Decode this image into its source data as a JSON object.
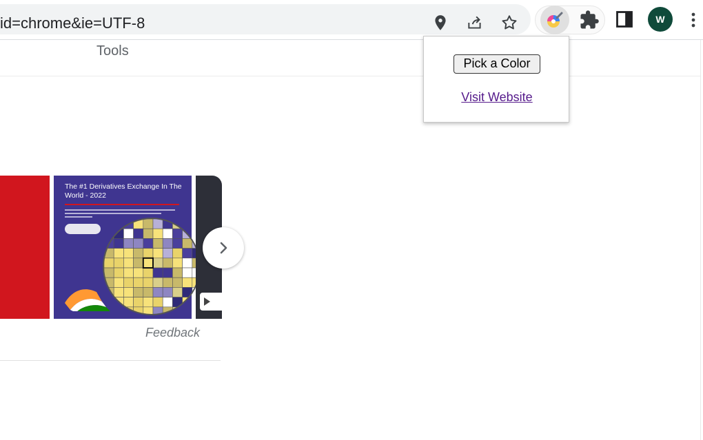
{
  "browser": {
    "url": "id=chrome&ie=UTF-8",
    "icons": {
      "location": "location-pin-icon",
      "share": "share-icon",
      "bookmark": "star-icon",
      "color_picker_extension": "color-picker-extension-icon",
      "extensions": "puzzle-piece-icon",
      "side_panel": "side-panel-icon",
      "menu": "kebab-menu-icon"
    },
    "avatar_initial": "W"
  },
  "page": {
    "tools_label": "Tools",
    "feedback_label": "Feedback",
    "carousel": {
      "card_headline": "The #1 Derivatives Exchange In The World - 2022"
    }
  },
  "popup": {
    "pick_label": "Pick a Color",
    "visit_label": "Visit Website"
  },
  "colors": {
    "accent_red": "#d1161e",
    "card_purple": "#3f3590",
    "avatar_green": "#0f4a3a",
    "link_visited": "#551a8b"
  }
}
